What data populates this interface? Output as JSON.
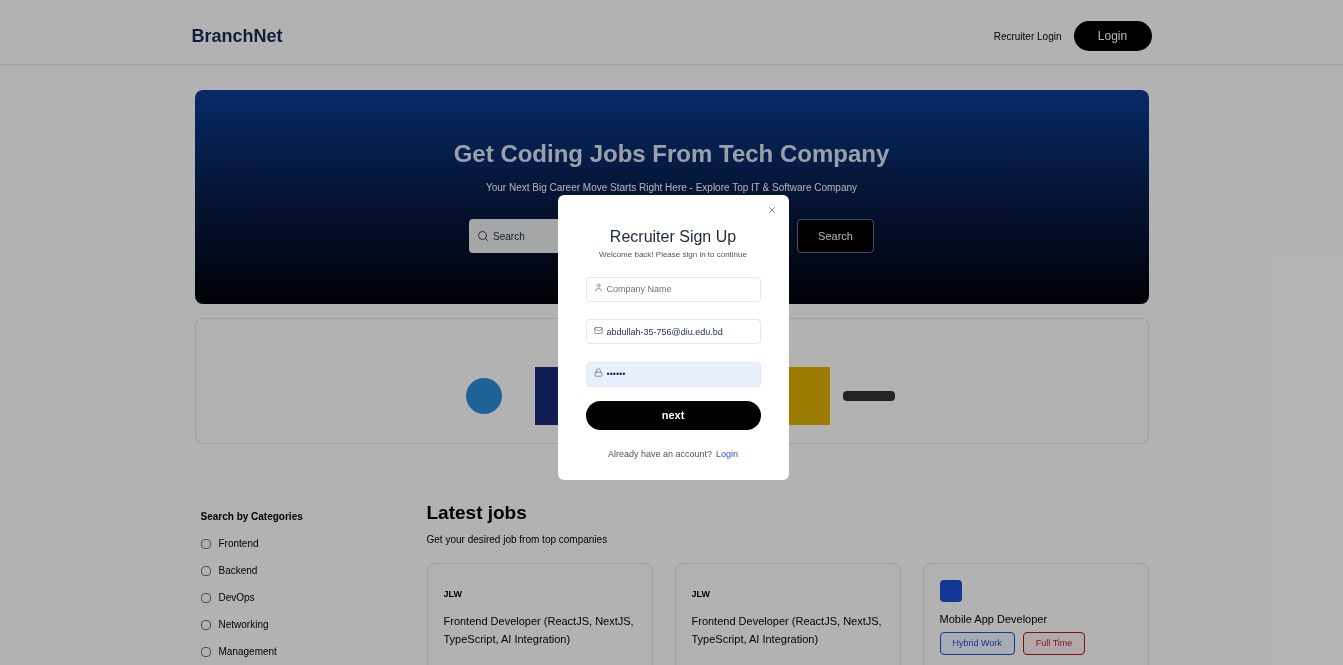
{
  "navbar": {
    "brand": "BranchNet",
    "links": [
      {
        "label": "Recruiter Login",
        "kind": "link"
      },
      {
        "label": "Login",
        "kind": "button"
      }
    ]
  },
  "hero": {
    "title": "Get Coding Jobs From Tech Company",
    "subtitle": "Your Next Big Career Move Starts Right Here - Explore Top IT & Software Company",
    "search": {
      "placeholder": "Search",
      "button": "Search"
    }
  },
  "companies": [
    {
      "kind": "circle"
    },
    {
      "kind": "navy"
    },
    {
      "kind": "yellow"
    },
    {
      "kind": "wordmark"
    }
  ],
  "sidebar": {
    "title": "Search by Categories",
    "categories": [
      {
        "label": "Frontend",
        "checked": false
      },
      {
        "label": "Backend",
        "checked": false
      },
      {
        "label": "DevOps",
        "checked": false
      },
      {
        "label": "Networking",
        "checked": false
      },
      {
        "label": "Management",
        "checked": false
      }
    ]
  },
  "jobs": {
    "title": "Latest jobs",
    "subtitle": "Get your desired job from top companies",
    "cards": [
      {
        "kind": "text",
        "company": "JLW",
        "title": "Frontend Developer (ReactJS, NextJS, TypeScript, AI Integration)"
      },
      {
        "kind": "text",
        "company": "JLW",
        "title": "Frontend Developer (ReactJS, NextJS, TypeScript, AI Integration)"
      },
      {
        "kind": "square",
        "title": "Mobile App Developer",
        "tags": [
          {
            "label": "Hybrid Work",
            "kind": "info"
          },
          {
            "label": "Full Time",
            "kind": "alert"
          }
        ]
      }
    ]
  },
  "modal": {
    "title": "Recruiter Sign Up",
    "subtitle": "Welcome back! Please sign in to continue",
    "fields": [
      {
        "kind": "company",
        "placeholder": "Company Name",
        "autofilled": false
      },
      {
        "kind": "email",
        "value": "abdullah-35-756@diu.edu.bd",
        "autofilled": false
      },
      {
        "kind": "password",
        "value": "••••••",
        "autofilled": true
      }
    ],
    "submit": "next",
    "footer": "Already have an account?",
    "footer_link": "Login"
  }
}
